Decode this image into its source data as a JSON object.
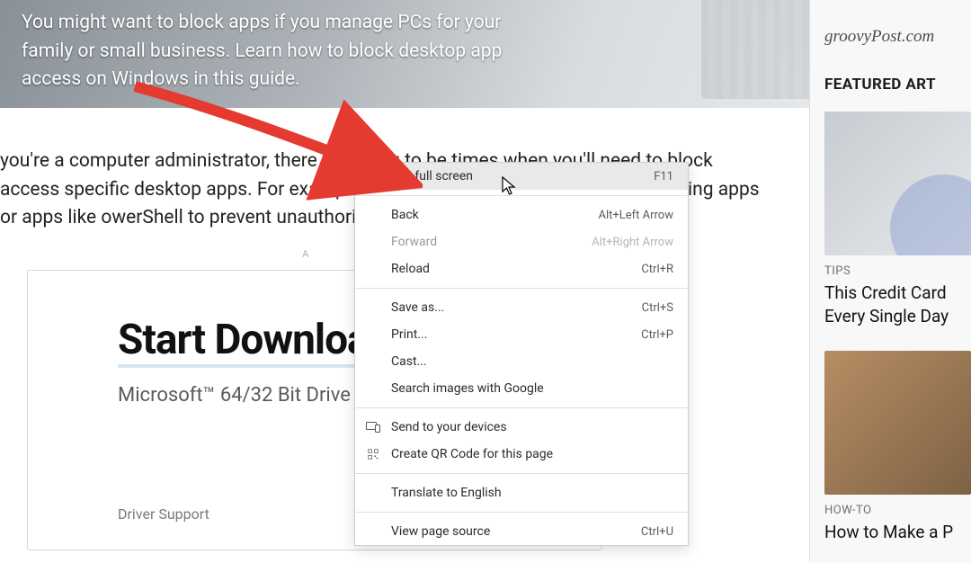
{
  "hero": {
    "text": "You might want to block apps if you manage PCs for your family or small business. Learn how to block desktop app access on Windows in this guide."
  },
  "article": {
    "paragraph": "you're a computer administrator, there are going to be times when you'll need to block access specific desktop apps. For example, you may want to block productivity-killing apps or apps like owerShell to prevent unauthorized access."
  },
  "ad_label": "A",
  "ad": {
    "headline": "Start Downloa",
    "sub": "Microsoft™ 64/32 Bit Drive",
    "brand": "Driver Support"
  },
  "sidebar": {
    "site": "groovyPost.com",
    "featured_heading": "FEATURED ART",
    "cards": [
      {
        "category": "TIPS",
        "title": "This Credit Card Every Single Day"
      },
      {
        "category": "HOW-TO",
        "title": "How to Make a P"
      }
    ]
  },
  "context_menu": {
    "items": [
      {
        "label": "Exit full screen",
        "accel": "F11",
        "highlight": true,
        "disabled": false,
        "icon": null
      },
      {
        "sep": true
      },
      {
        "label": "Back",
        "accel": "Alt+Left Arrow",
        "highlight": false,
        "disabled": false,
        "icon": null
      },
      {
        "label": "Forward",
        "accel": "Alt+Right Arrow",
        "highlight": false,
        "disabled": true,
        "icon": null
      },
      {
        "label": "Reload",
        "accel": "Ctrl+R",
        "highlight": false,
        "disabled": false,
        "icon": null
      },
      {
        "sep": true
      },
      {
        "label": "Save as...",
        "accel": "Ctrl+S",
        "highlight": false,
        "disabled": false,
        "icon": null
      },
      {
        "label": "Print...",
        "accel": "Ctrl+P",
        "highlight": false,
        "disabled": false,
        "icon": null
      },
      {
        "label": "Cast...",
        "accel": "",
        "highlight": false,
        "disabled": false,
        "icon": null
      },
      {
        "label": "Search images with Google",
        "accel": "",
        "highlight": false,
        "disabled": false,
        "icon": null
      },
      {
        "sep": true
      },
      {
        "label": "Send to your devices",
        "accel": "",
        "highlight": false,
        "disabled": false,
        "icon": "devices-icon"
      },
      {
        "label": "Create QR Code for this page",
        "accel": "",
        "highlight": false,
        "disabled": false,
        "icon": "qr-icon"
      },
      {
        "sep": true
      },
      {
        "label": "Translate to English",
        "accel": "",
        "highlight": false,
        "disabled": false,
        "icon": null
      },
      {
        "sep": true
      },
      {
        "label": "View page source",
        "accel": "Ctrl+U",
        "highlight": false,
        "disabled": false,
        "icon": null
      }
    ]
  }
}
